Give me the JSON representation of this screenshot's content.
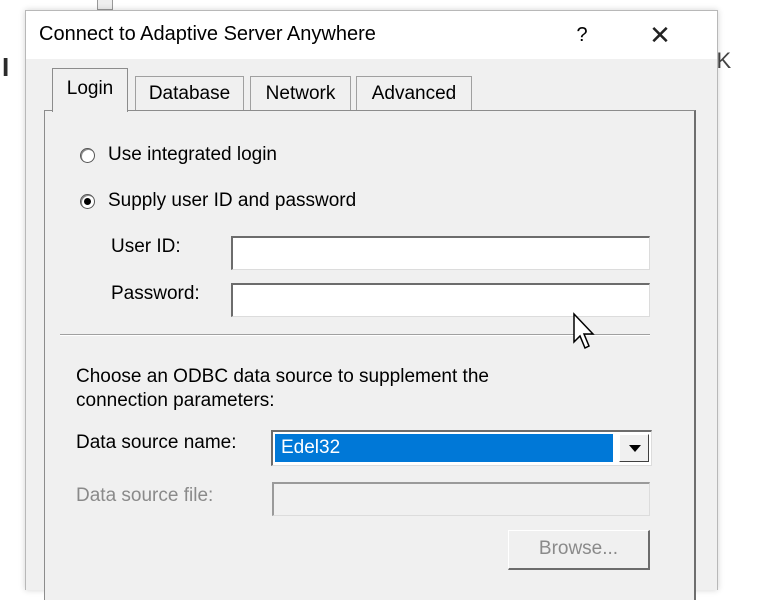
{
  "background": {
    "left_fragment": "I",
    "right_fragment": "› OK"
  },
  "dialog": {
    "title": "Connect to Adaptive Server Anywhere",
    "help_button": "?",
    "close_button": "✕"
  },
  "tabs": [
    {
      "label": "Login",
      "active": true
    },
    {
      "label": "Database",
      "active": false
    },
    {
      "label": "Network",
      "active": false
    },
    {
      "label": "Advanced",
      "active": false
    }
  ],
  "login": {
    "radio_integrated": {
      "label": "Use integrated login",
      "selected": false
    },
    "radio_supply": {
      "label": "Supply user ID and password",
      "selected": true
    },
    "user_id": {
      "label": "User ID:",
      "value": ""
    },
    "password": {
      "label": "Password:",
      "value": ""
    },
    "odbc_intro": "Choose an ODBC data source to supplement the",
    "odbc_intro2": "connection parameters:",
    "data_source_name": {
      "label": "Data source name:",
      "value": "Edel32"
    },
    "data_source_file": {
      "label": "Data source file:",
      "value": "",
      "disabled": true
    },
    "browse_button": "Browse..."
  },
  "colors": {
    "selection": "#0078d7",
    "dialog_bg": "#f0f0f0",
    "disabled_text": "#8a8a8a"
  }
}
